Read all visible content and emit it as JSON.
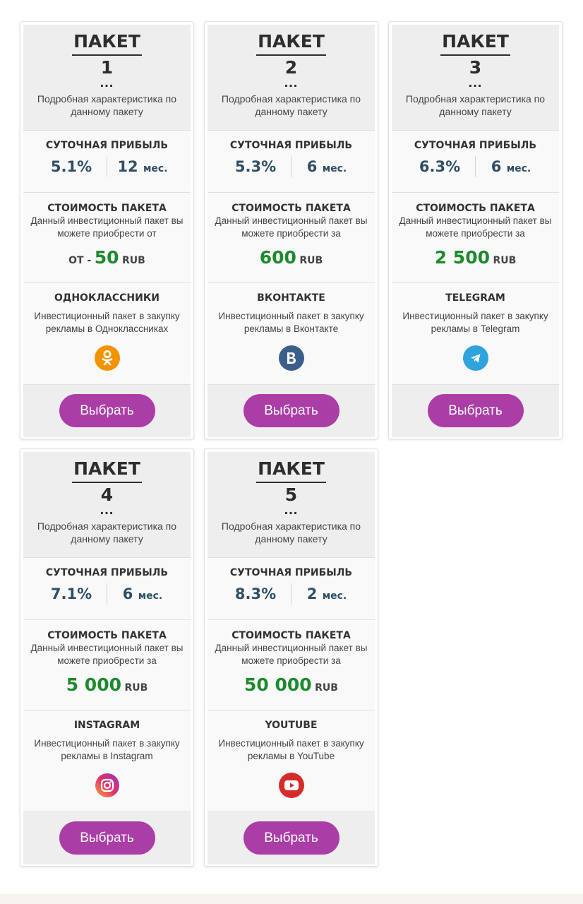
{
  "labels": {
    "title": "ПАКЕТ",
    "desc": "Подробная характеристика по данному пакету",
    "profit_label": "СУТОЧНАЯ ПРИБЫЛЬ",
    "cost_label": "СТОИМОСТЬ ПАКЕТА",
    "currency": "RUB",
    "term_unit": "мес.",
    "dots": "..."
  },
  "packages": [
    {
      "number": "1",
      "rate": "5.1%",
      "term": "12",
      "cost_desc": "Данный инвестиционный пакет вы можете приобрести от",
      "cost_prefix": "ОТ -",
      "price": "50",
      "network": "ОДНОКЛАССНИКИ",
      "network_desc": "Инвестиционный пакет в закупку рекламы в Одноклассниках",
      "icon": "odnoklassniki-icon",
      "icon_color": "#f29400",
      "button": "Выбрать"
    },
    {
      "number": "2",
      "rate": "5.3%",
      "term": "6",
      "cost_desc": "Данный инвестиционный пакет вы можете приобрести за",
      "cost_prefix": "",
      "price": "600",
      "network": "ВКОНТАКТЕ",
      "network_desc": "Инвестиционный пакет в закупку рекламы в Вконтакте",
      "icon": "vk-icon",
      "icon_color": "#3b5f8a",
      "button": "Выбрать"
    },
    {
      "number": "3",
      "rate": "6.3%",
      "term": "6",
      "cost_desc": "Данный инвестиционный пакет вы можете приобрести за",
      "cost_prefix": "",
      "price": "2 500",
      "network": "TELEGRAM",
      "network_desc": "Инвестиционный пакет в закупку рекламы в Telegram",
      "icon": "telegram-icon",
      "icon_color": "#2fa3dc",
      "button": "Выбрать"
    },
    {
      "number": "4",
      "rate": "7.1%",
      "term": "6",
      "cost_desc": "Данный инвестиционный пакет вы можете приобрести за",
      "cost_prefix": "",
      "price": "5 000",
      "network": "INSTAGRAM",
      "network_desc": "Инвестиционный пакет в закупку рекламы в Instagram",
      "icon": "instagram-icon",
      "icon_color": "#c13584",
      "button": "Выбрать"
    },
    {
      "number": "5",
      "rate": "8.3%",
      "term": "2",
      "cost_desc": "Данный инвестиционный пакет вы можете приобрести за",
      "cost_prefix": "",
      "price": "50 000",
      "network": "YOUTUBE",
      "network_desc": "Инвестиционный пакет в закупку рекламы в YouTube",
      "icon": "youtube-icon",
      "icon_color": "#d52b2b",
      "button": "Выбрать"
    }
  ]
}
